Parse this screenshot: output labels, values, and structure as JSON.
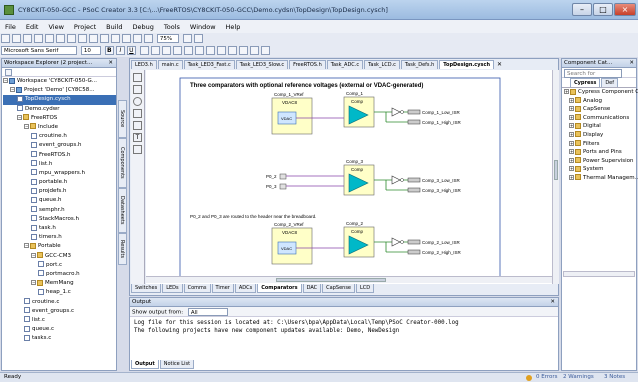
{
  "window": {
    "title": "CY8CKIT-050-GCC - PSoC Creator 3.3  [C:\\...\\FreeRTOS\\CY8CKIT-050-GCC\\Demo.cydsn\\TopDesign\\TopDesign.cysch]"
  },
  "menu": [
    "File",
    "Edit",
    "View",
    "Project",
    "Build",
    "Debug",
    "Tools",
    "Window",
    "Help"
  ],
  "toolbar": {
    "zoom": "75%",
    "font": "Microsoft Sans Serif",
    "size": "10",
    "bold": "B",
    "italic": "I",
    "underline": "U"
  },
  "workspace": {
    "header": "Workspace Explorer (2 project...",
    "tree": [
      {
        "indent": 0,
        "label": "Workspace 'CY8CKIT-050-G...",
        "kind": "prj"
      },
      {
        "indent": 1,
        "label": "Project 'Demo' [CY8C58...",
        "kind": "prj"
      },
      {
        "indent": 2,
        "label": "TopDesign.cysch",
        "kind": "file",
        "sel": true
      },
      {
        "indent": 2,
        "label": "Demo.cydwr",
        "kind": "file"
      },
      {
        "indent": 2,
        "label": "FreeRTOS",
        "kind": "fold"
      },
      {
        "indent": 3,
        "label": "Include",
        "kind": "fold"
      },
      {
        "indent": 4,
        "label": "croutine.h",
        "kind": "file"
      },
      {
        "indent": 4,
        "label": "event_groups.h",
        "kind": "file"
      },
      {
        "indent": 4,
        "label": "FreeRTOS.h",
        "kind": "file"
      },
      {
        "indent": 4,
        "label": "list.h",
        "kind": "file"
      },
      {
        "indent": 4,
        "label": "mpu_wrappers.h",
        "kind": "file"
      },
      {
        "indent": 4,
        "label": "portable.h",
        "kind": "file"
      },
      {
        "indent": 4,
        "label": "projdefs.h",
        "kind": "file"
      },
      {
        "indent": 4,
        "label": "queue.h",
        "kind": "file"
      },
      {
        "indent": 4,
        "label": "semphr.h",
        "kind": "file"
      },
      {
        "indent": 4,
        "label": "StackMacros.h",
        "kind": "file"
      },
      {
        "indent": 4,
        "label": "task.h",
        "kind": "file"
      },
      {
        "indent": 4,
        "label": "timers.h",
        "kind": "file"
      },
      {
        "indent": 3,
        "label": "Portable",
        "kind": "fold"
      },
      {
        "indent": 4,
        "label": "GCC-CM3",
        "kind": "fold"
      },
      {
        "indent": 5,
        "label": "port.c",
        "kind": "file"
      },
      {
        "indent": 5,
        "label": "portmacro.h",
        "kind": "file"
      },
      {
        "indent": 4,
        "label": "MemMang",
        "kind": "fold"
      },
      {
        "indent": 5,
        "label": "heap_1.c",
        "kind": "file"
      },
      {
        "indent": 3,
        "label": "croutine.c",
        "kind": "file"
      },
      {
        "indent": 3,
        "label": "event_groups.c",
        "kind": "file"
      },
      {
        "indent": 3,
        "label": "list.c",
        "kind": "file"
      },
      {
        "indent": 3,
        "label": "queue.c",
        "kind": "file"
      },
      {
        "indent": 3,
        "label": "tasks.c",
        "kind": "file"
      }
    ],
    "vtabs": [
      "Source",
      "Components",
      "Datasheets",
      "Results"
    ]
  },
  "docTabs": [
    "LED3.h",
    "main.c",
    "Task_LED3_Fast.c",
    "Task_LED3_Slow.c",
    "FreeRTOS.h",
    "Task_ADC.c",
    "Task_LCD.c",
    "Task_Defs.h",
    "TopDesign.cysch"
  ],
  "schematic": {
    "title": "Three comparators with optional reference voltages (external or VDAC-generated)",
    "note": "P0_2 and P0_3 are routed to the header near the breadboard.",
    "blocks": [
      {
        "vref": "Comp_1_VRef",
        "vdac_type": "VDAC8",
        "vdac_label": "VDAC",
        "comp": "Comp_1",
        "comp_type": "Comp",
        "out_low": "Comp_1_Low_ISR",
        "out_high": "Comp_1_High_ISR"
      },
      {
        "vref": "",
        "vdac_type": "",
        "vdac_label": "",
        "comp": "Comp_3",
        "comp_type": "Comp",
        "out_low": "Comp_3_Low_ISR",
        "out_high": "Comp_3_High_ISR",
        "pin_a": "P0_2",
        "pin_b": "P0_3"
      },
      {
        "vref": "Comp_2_VRef",
        "vdac_type": "VDAC8",
        "vdac_label": "VDAC",
        "comp": "Comp_2",
        "comp_type": "Comp",
        "out_low": "Comp_2_Low_ISR",
        "out_high": "Comp_2_High_ISR"
      }
    ]
  },
  "sheetTabs": [
    "Switches",
    "LEDs",
    "Comms",
    "Timer",
    "ADCs",
    "Comparators",
    "DAC",
    "CapSense",
    "LCD"
  ],
  "output": {
    "header": "Output",
    "from_label": "Show output from:",
    "from_value": "All",
    "lines": [
      "Log file for this session is located at: C:\\Users\\bpa\\AppData\\Local\\Temp\\PSoC Creator-000.log",
      "The following projects have new component updates available: Demo, NewDesign"
    ],
    "tabs": [
      "Output",
      "Notice List"
    ]
  },
  "catalog": {
    "header": "Component Cat...",
    "search": "Search for",
    "tabs": [
      "Cypress",
      "Def"
    ],
    "items": [
      "Cypress Component C...",
      "Analog",
      "CapSense",
      "Communications",
      "Digital",
      "Display",
      "Filters",
      "Ports and Pins",
      "Power Supervision",
      "System",
      "Thermal Managem..."
    ]
  },
  "status": {
    "left": "Ready",
    "errors": "0 Errors",
    "warnings": "2 Warnings",
    "notes": "3 Notes"
  },
  "colors": {
    "accent": "#3a6fb5",
    "comp_fill": "#00b8c8",
    "block_fill": "#ffffc8"
  }
}
